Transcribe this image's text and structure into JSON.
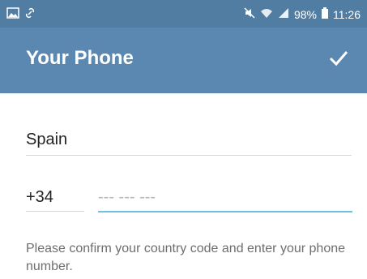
{
  "status_bar": {
    "left_icons": [
      "image-icon",
      "link-icon"
    ],
    "right_icons": [
      "mute-icon",
      "wifi-icon",
      "signal-icon",
      "battery-icon"
    ],
    "battery": "98%",
    "time": "11:26"
  },
  "app_bar": {
    "title": "Your Phone",
    "confirm_icon": "check-icon",
    "background": "#5b88b0",
    "status_background": "#527da3"
  },
  "form": {
    "country": "Spain",
    "country_code": "+34",
    "phone_placeholder": "--- --- ---",
    "phone_value": "",
    "accent": "#6cc2e0"
  },
  "hint": {
    "text": "Please confirm your country code and enter your phone number."
  }
}
